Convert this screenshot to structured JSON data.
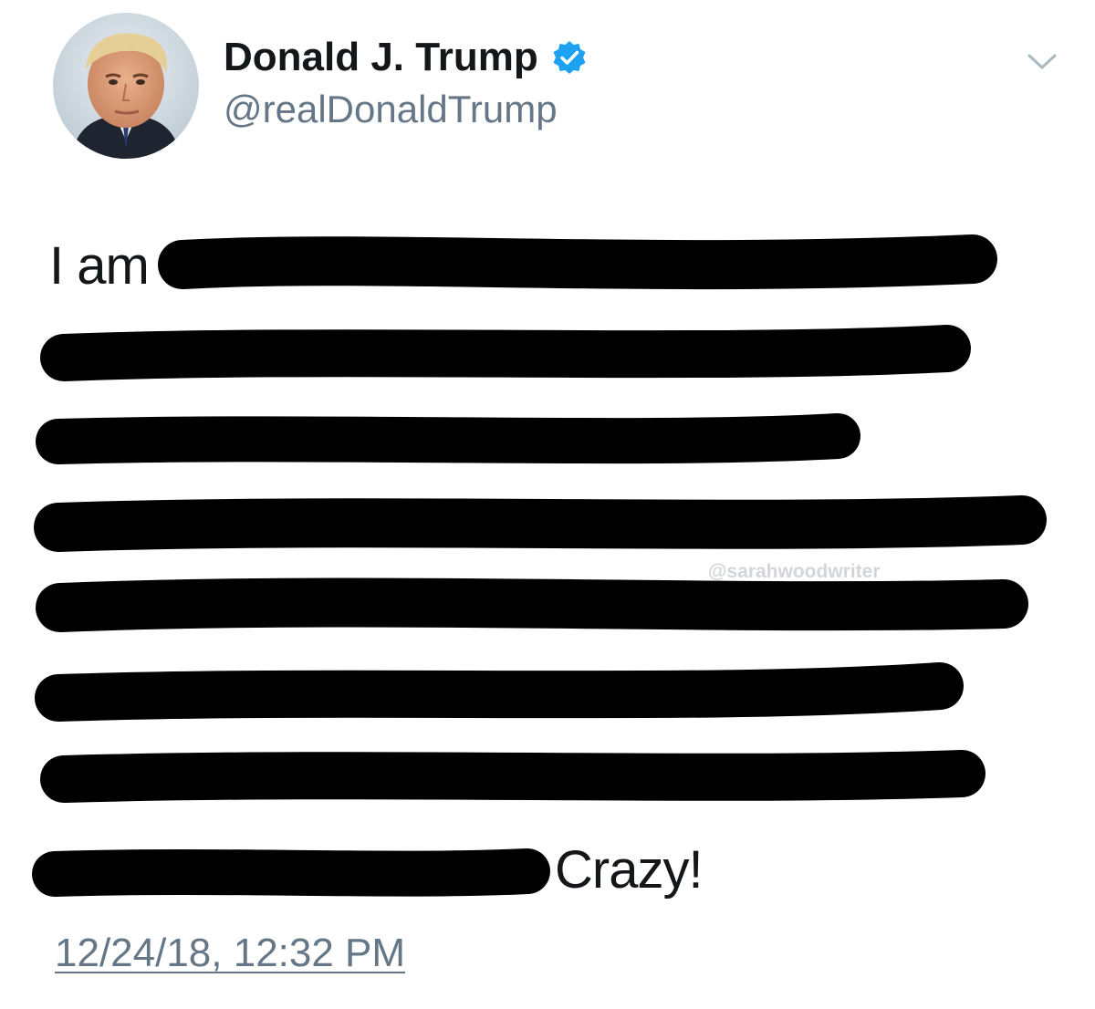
{
  "author": {
    "display_name": "Donald J. Trump",
    "handle": "@realDonaldTrump",
    "verified": true,
    "avatar_icon": "profile-photo"
  },
  "tweet": {
    "text_start": "I am",
    "text_end": "Crazy!",
    "redacted_lines": 8,
    "timestamp": "12/24/18, 12:32 PM"
  },
  "watermark": "@sarahwoodwriter",
  "colors": {
    "verified_badge": "#1da1f2",
    "text": "#14171a",
    "secondary": "#657786",
    "redaction": "#000000"
  },
  "icons": {
    "verified": "verified-badge-icon",
    "menu": "chevron-down-icon"
  }
}
